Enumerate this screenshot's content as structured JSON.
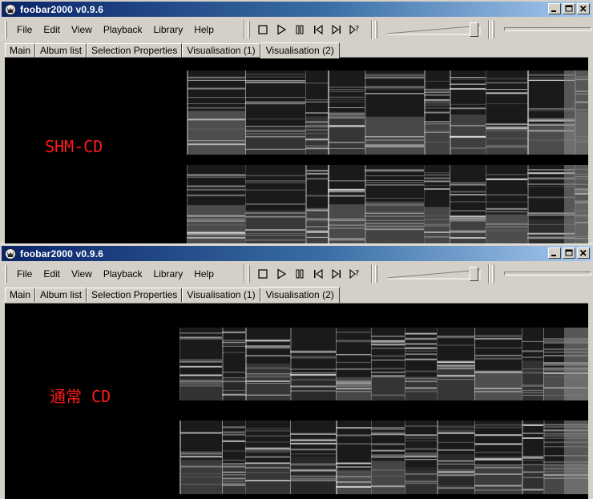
{
  "colors": {
    "title_gradient_start": "#0a246a",
    "title_gradient_end": "#a6caf0",
    "face": "#d4d0c8",
    "vis_background": "#000000",
    "label_color": "#ff1a1a"
  },
  "windows": [
    {
      "title": "foobar2000  v0.9.6",
      "menu": [
        "File",
        "Edit",
        "View",
        "Playback",
        "Library",
        "Help"
      ],
      "transport_icons": [
        "stop-icon",
        "play-icon",
        "pause-icon",
        "previous-icon",
        "next-icon",
        "random-icon"
      ],
      "volume_level": 0.95,
      "tabs": [
        "Main",
        "Album list",
        "Selection Properties",
        "Visualisation (1)",
        "Visualisation (2)"
      ],
      "active_tab": 4,
      "vis_label": "SHM-CD"
    },
    {
      "title": "foobar2000  v0.9.6",
      "menu": [
        "File",
        "Edit",
        "View",
        "Playback",
        "Library",
        "Help"
      ],
      "transport_icons": [
        "stop-icon",
        "play-icon",
        "pause-icon",
        "previous-icon",
        "next-icon",
        "random-icon"
      ],
      "volume_level": 0.95,
      "tabs": [
        "Main",
        "Album list",
        "Selection Properties",
        "Visualisation (1)",
        "Visualisation (2)"
      ],
      "active_tab": 4,
      "vis_label": "通常 CD"
    }
  ]
}
